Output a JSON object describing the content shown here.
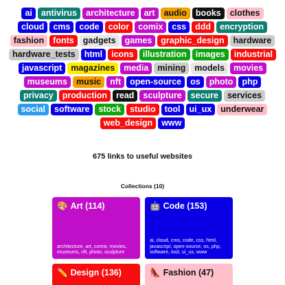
{
  "tags": [
    {
      "label": "ai",
      "bg": "#0a00e6",
      "fg": "#ffffff"
    },
    {
      "label": "antivirus",
      "bg": "#0d7f72",
      "fg": "#ffffff"
    },
    {
      "label": "architecture",
      "bg": "#c10ec9",
      "fg": "#ffffff"
    },
    {
      "label": "art",
      "bg": "#c10ec9",
      "fg": "#ffffff"
    },
    {
      "label": "audio",
      "bg": "#f5a000",
      "fg": "#111111"
    },
    {
      "label": "books",
      "bg": "#111111",
      "fg": "#ffffff"
    },
    {
      "label": "clothes",
      "bg": "#ffc0cb",
      "fg": "#111111"
    },
    {
      "label": "cloud",
      "bg": "#0a00e6",
      "fg": "#ffffff"
    },
    {
      "label": "cms",
      "bg": "#0a00e6",
      "fg": "#ffffff"
    },
    {
      "label": "code",
      "bg": "#0a00e6",
      "fg": "#ffffff"
    },
    {
      "label": "color",
      "bg": "#f70d0d",
      "fg": "#ffffff"
    },
    {
      "label": "comix",
      "bg": "#c10ec9",
      "fg": "#ffffff"
    },
    {
      "label": "css",
      "bg": "#0a00e6",
      "fg": "#ffffff"
    },
    {
      "label": "ddd",
      "bg": "#f70d0d",
      "fg": "#ffffff"
    },
    {
      "label": "encryption",
      "bg": "#0d7f72",
      "fg": "#ffffff"
    },
    {
      "label": "fashion",
      "bg": "#ffc0cb",
      "fg": "#111111"
    },
    {
      "label": "fonts",
      "bg": "#f70d0d",
      "fg": "#ffffff"
    },
    {
      "label": "gadgets",
      "bg": "#e6e6e6",
      "fg": "#111111"
    },
    {
      "label": "games",
      "bg": "#c10ec9",
      "fg": "#ffffff"
    },
    {
      "label": "graphic_design",
      "bg": "#f70d0d",
      "fg": "#ffffff"
    },
    {
      "label": "hardware",
      "bg": "#cccccc",
      "fg": "#111111"
    },
    {
      "label": "hardware_tests",
      "bg": "#cccccc",
      "fg": "#111111"
    },
    {
      "label": "html",
      "bg": "#0a00e6",
      "fg": "#ffffff"
    },
    {
      "label": "icons",
      "bg": "#f70d0d",
      "fg": "#ffffff"
    },
    {
      "label": "illustration",
      "bg": "#10a310",
      "fg": "#ffffff"
    },
    {
      "label": "images",
      "bg": "#10a310",
      "fg": "#ffffff"
    },
    {
      "label": "industrial",
      "bg": "#f70d0d",
      "fg": "#ffffff"
    },
    {
      "label": "javascript",
      "bg": "#0a00e6",
      "fg": "#ffffff"
    },
    {
      "label": "magazines",
      "bg": "#ffeb00",
      "fg": "#111111"
    },
    {
      "label": "media",
      "bg": "#c10ec9",
      "fg": "#ffffff"
    },
    {
      "label": "mining",
      "bg": "#cccccc",
      "fg": "#111111"
    },
    {
      "label": "models",
      "bg": "#e6e6e6",
      "fg": "#111111"
    },
    {
      "label": "movies",
      "bg": "#c10ec9",
      "fg": "#ffffff"
    },
    {
      "label": "museums",
      "bg": "#c10ec9",
      "fg": "#ffffff"
    },
    {
      "label": "music",
      "bg": "#f5a000",
      "fg": "#111111"
    },
    {
      "label": "nft",
      "bg": "#c10ec9",
      "fg": "#ffffff"
    },
    {
      "label": "open-source",
      "bg": "#0a00e6",
      "fg": "#ffffff"
    },
    {
      "label": "os",
      "bg": "#0a00e6",
      "fg": "#ffffff"
    },
    {
      "label": "photo",
      "bg": "#c10ec9",
      "fg": "#ffffff"
    },
    {
      "label": "php",
      "bg": "#0a00e6",
      "fg": "#ffffff"
    },
    {
      "label": "privacy",
      "bg": "#0d7f72",
      "fg": "#ffffff"
    },
    {
      "label": "production",
      "bg": "#f70d0d",
      "fg": "#ffffff"
    },
    {
      "label": "read",
      "bg": "#111111",
      "fg": "#ffffff"
    },
    {
      "label": "sculpture",
      "bg": "#c10ec9",
      "fg": "#ffffff"
    },
    {
      "label": "secure",
      "bg": "#0d7f72",
      "fg": "#ffffff"
    },
    {
      "label": "services",
      "bg": "#cccccc",
      "fg": "#111111"
    },
    {
      "label": "social",
      "bg": "#2e9bf0",
      "fg": "#ffffff"
    },
    {
      "label": "software",
      "bg": "#0a00e6",
      "fg": "#ffffff"
    },
    {
      "label": "stock",
      "bg": "#10a310",
      "fg": "#ffffff"
    },
    {
      "label": "studio",
      "bg": "#f70d0d",
      "fg": "#ffffff"
    },
    {
      "label": "tool",
      "bg": "#0a00e6",
      "fg": "#ffffff"
    },
    {
      "label": "ui_ux",
      "bg": "#0a00e6",
      "fg": "#ffffff"
    },
    {
      "label": "underwear",
      "bg": "#ffc0cb",
      "fg": "#111111"
    },
    {
      "label": "web_design",
      "bg": "#f70d0d",
      "fg": "#ffffff"
    },
    {
      "label": "www",
      "bg": "#0a00e6",
      "fg": "#ffffff"
    }
  ],
  "summary": {
    "links_count": "675 links to useful websites",
    "collections_heading": "Collections (10)"
  },
  "collections": {
    "art": {
      "emoji": "🎨",
      "title": "Art (114)",
      "tags": "architecture, art, comix, movies, museums, nft, photo, sculpture"
    },
    "code": {
      "emoji": "🤖",
      "title": "Code (153)",
      "tags": "ai, cloud, cms, code, css, html, javascript, open-source, os, php, software, tool, ui_ux, www"
    },
    "design": {
      "emoji": "✏️",
      "title": "Design (136)",
      "tags": ""
    },
    "fashion": {
      "emoji": "👠",
      "title": "Fashion (47)",
      "tags": ""
    }
  }
}
